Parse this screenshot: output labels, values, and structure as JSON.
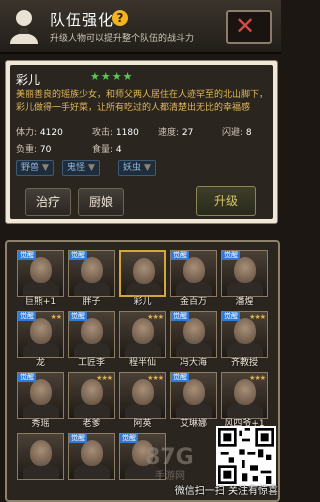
{
  "header": {
    "title": "队伍强化",
    "subtitle": "升级人物可以提升整个队伍的战斗力",
    "help_label": "?",
    "close_label": "✕"
  },
  "character": {
    "name": "彩儿",
    "stars": 4,
    "stars_text": "★★★★",
    "description": "美丽善良的瑶族少女，和师父两人居住在人迹罕至的北山脚下，彩儿做得一手好菜，让所有吃过的人都清楚出无比的幸福感",
    "stats": [
      {
        "label": "体力:",
        "value": "4120"
      },
      {
        "label": "攻击:",
        "value": "1180"
      },
      {
        "label": "速度:",
        "value": "27"
      },
      {
        "label": "闪避:",
        "value": "8"
      },
      {
        "label": "负重:",
        "value": "70"
      },
      {
        "label": "食量:",
        "value": "4"
      }
    ],
    "tags": [
      {
        "label": "野兽"
      },
      {
        "label": "鬼怪"
      },
      {
        "label": "妖虫"
      }
    ]
  },
  "actions": {
    "heal": "治疗",
    "cook": "厨娘",
    "upgrade": "升级"
  },
  "roster": [
    {
      "name": "巨熊+1",
      "badge": "觉醒",
      "stars": "",
      "highlight": false
    },
    {
      "name": "胖子",
      "badge": "觉醒",
      "stars": "",
      "highlight": false
    },
    {
      "name": "彩儿",
      "badge": "",
      "stars": "",
      "highlight": true
    },
    {
      "name": "金百万",
      "badge": "觉醒",
      "stars": "",
      "highlight": false
    },
    {
      "name": "潘煌",
      "badge": "觉醒",
      "stars": "",
      "highlight": false
    },
    {
      "name": "龙",
      "badge": "觉醒",
      "stars": "★★",
      "highlight": false
    },
    {
      "name": "工匠李",
      "badge": "觉醒",
      "stars": "",
      "highlight": false
    },
    {
      "name": "程半仙",
      "badge": "",
      "stars": "★★★",
      "highlight": false
    },
    {
      "name": "冯大海",
      "badge": "觉醒",
      "stars": "",
      "highlight": false
    },
    {
      "name": "齐教授",
      "badge": "觉醒",
      "stars": "★★★",
      "highlight": false
    },
    {
      "name": "秀瑶",
      "badge": "觉醒",
      "stars": "",
      "highlight": false
    },
    {
      "name": "老爹",
      "badge": "",
      "stars": "★★★",
      "highlight": false
    },
    {
      "name": "阿英",
      "badge": "",
      "stars": "★★★",
      "highlight": false
    },
    {
      "name": "艾琳娜",
      "badge": "觉醒",
      "stars": "",
      "highlight": false
    },
    {
      "name": "风四爷+1",
      "badge": "",
      "stars": "★★★",
      "highlight": false
    },
    {
      "name": "",
      "badge": "",
      "stars": "",
      "highlight": false
    },
    {
      "name": "",
      "badge": "觉醒",
      "stars": "",
      "highlight": false
    },
    {
      "name": "",
      "badge": "觉醒",
      "stars": "",
      "highlight": false
    }
  ],
  "watermark": {
    "logo": "87G",
    "sub": "手游网",
    "text": "微信扫一扫 关注有惊喜"
  }
}
